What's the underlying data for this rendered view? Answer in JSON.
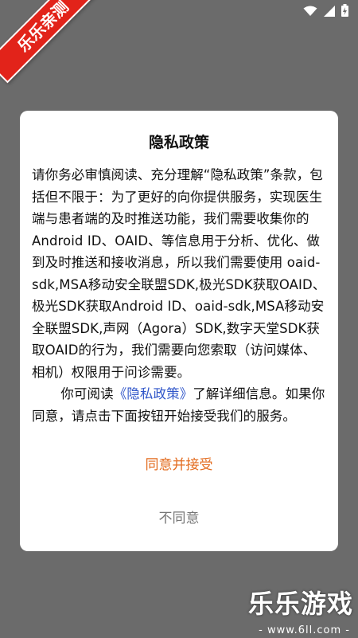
{
  "watermark": {
    "ribbon_text": "乐乐亲测",
    "brand": "乐乐游戏",
    "url": "- www.6ll.com -"
  },
  "status_bar": {
    "icons": [
      "wifi-icon",
      "signal-icon",
      "battery-charging-icon"
    ]
  },
  "dialog": {
    "title": "隐私政策",
    "paragraph1": "请你务必审慎阅读、充分理解“隐私政策”条款，包括但不限于：为了更好的向你提供服务，实现医生端与患者端的及时推送功能，我们需要收集你的Android ID、OAID、等信息用于分析、优化、做到及时推送和接收消息，所以我们需要使用 oaid-sdk,MSA移动安全联盟SDK,极光SDK获取OAID、极光SDK获取Android ID、oaid-sdk,MSA移动安全联盟SDK,声网（Agora）SDK,数字天堂SDK获取OAID的行为，我们需要向您索取（访问媒体、相机）权限用于问诊需要。",
    "paragraph2_prefix": "你可阅读",
    "paragraph2_link": "《隐私政策》",
    "paragraph2_suffix": "了解详细信息。如果你同意，请点击下面按钮开始接受我们的服务。",
    "agree_label": "同意并接受",
    "disagree_label": "不同意"
  },
  "colors": {
    "overlay": "#6b6b6b",
    "accent": "#e36b1e",
    "link": "#2f55c9",
    "ribbon": "#e2231a"
  }
}
